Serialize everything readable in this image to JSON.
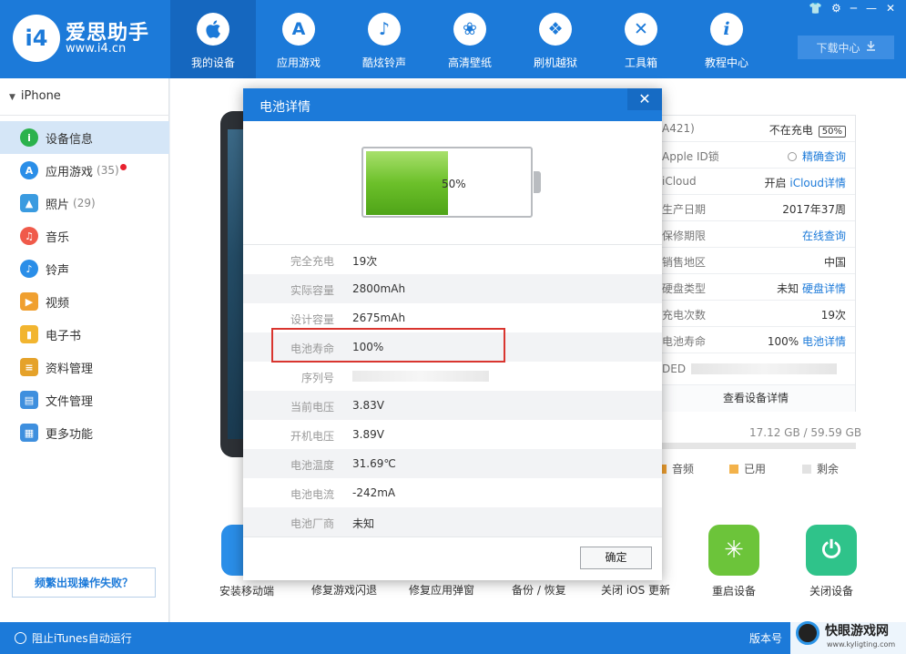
{
  "app": {
    "logo_mark": "i4",
    "title": "爱思助手",
    "url": "www.i4.cn"
  },
  "nav": [
    {
      "label": "我的设备",
      "icon": "apple-icon",
      "glyph": "",
      "active": true
    },
    {
      "label": "应用游戏",
      "icon": "app-store-icon",
      "glyph": "A"
    },
    {
      "label": "酷炫铃声",
      "icon": "bell-icon",
      "glyph": "♪"
    },
    {
      "label": "高清壁纸",
      "icon": "flower-icon",
      "glyph": "❀"
    },
    {
      "label": "刷机越狱",
      "icon": "dropbox-icon",
      "glyph": "❖"
    },
    {
      "label": "工具箱",
      "icon": "tools-icon",
      "glyph": "✕"
    },
    {
      "label": "教程中心",
      "icon": "info-icon",
      "glyph": "i"
    }
  ],
  "window_controls": [
    "👕",
    "⚙",
    "─",
    "—",
    "✕"
  ],
  "download_center": "下载中心",
  "sidebar": {
    "device": "iPhone",
    "items": [
      {
        "label": "设备信息",
        "icon": "info-circle-icon",
        "color": "#2bb24c",
        "glyph": "i",
        "active": true
      },
      {
        "label": "应用游戏",
        "count": "(35)",
        "icon": "app-store-icon",
        "color": "#2a8ee8",
        "glyph": "A",
        "badge": true
      },
      {
        "label": "照片",
        "count": "(29)",
        "icon": "photo-icon",
        "color": "#3a9be0",
        "glyph": "▲"
      },
      {
        "label": "音乐",
        "icon": "music-icon",
        "color": "#f05a4a",
        "glyph": "♫"
      },
      {
        "label": "铃声",
        "icon": "bell-icon",
        "color": "#2a8ee8",
        "glyph": "♪"
      },
      {
        "label": "视频",
        "icon": "video-icon",
        "color": "#f0a030",
        "glyph": "▶"
      },
      {
        "label": "电子书",
        "icon": "book-icon",
        "color": "#f2b530",
        "glyph": "▮"
      },
      {
        "label": "资料管理",
        "icon": "contacts-icon",
        "color": "#e5a22a",
        "glyph": "≡"
      },
      {
        "label": "文件管理",
        "icon": "file-icon",
        "color": "#3e8fde",
        "glyph": "▤"
      },
      {
        "label": "更多功能",
        "icon": "grid-icon",
        "color": "#3e8fde",
        "glyph": "▦"
      }
    ],
    "fail_button": "频繁出现操作失败？"
  },
  "bottom": {
    "itunes": "阻止iTunes自动运行",
    "version": "版本号"
  },
  "info_panel": {
    "model_suffix": "A421)",
    "charge_status": "不在充电",
    "battery_badge": "50%",
    "rows": [
      {
        "k": "Apple ID锁",
        "v": "",
        "link": "精确查询",
        "radio": true
      },
      {
        "k": "iCloud",
        "v": "开启",
        "link": "iCloud详情"
      },
      {
        "k": "生产日期",
        "v": "2017年37周"
      },
      {
        "k": "保修期限",
        "v": "",
        "link": "在线查询"
      },
      {
        "k": "销售地区",
        "v": "中国"
      },
      {
        "k": "硬盘类型",
        "v": "未知",
        "link": "硬盘详情"
      },
      {
        "k": "充电次数",
        "v": "19次"
      },
      {
        "k": "电池寿命",
        "v": "100%",
        "link": "电池详情"
      }
    ],
    "serial_prefix": "DED",
    "detail_button": "查看设备详情",
    "storage": "17.12 GB / 59.59 GB",
    "legend": [
      {
        "label": "音频",
        "color": "#f0a030"
      },
      {
        "label": "已用",
        "color": "#f3b24a"
      },
      {
        "label": "剩余",
        "color": "#e2e2e2"
      }
    ]
  },
  "tools": [
    {
      "label": "安装移动端",
      "icon": "i4-app-icon",
      "color": "#2a8ee8",
      "glyph": "i"
    },
    {
      "label": "修复游戏闪退"
    },
    {
      "label": "修复应用弹窗"
    },
    {
      "label": "备份 / 恢复"
    },
    {
      "label": "关闭 iOS 更新"
    },
    {
      "label": "重启设备",
      "icon": "restart-icon",
      "color": "#6cc43a",
      "glyph": "✳"
    },
    {
      "label": "关闭设备",
      "icon": "power-icon",
      "color": "#2fc38a",
      "glyph": "⏻"
    }
  ],
  "modal": {
    "title": "电池详情",
    "close": "✕",
    "battery_percent": "50%",
    "battery_level": 0.5,
    "rows": [
      {
        "k": "完全充电",
        "v": "19次"
      },
      {
        "k": "实际容量",
        "v": "2800mAh"
      },
      {
        "k": "设计容量",
        "v": "2675mAh"
      },
      {
        "k": "电池寿命",
        "v": "100%"
      },
      {
        "k": "序列号",
        "v": "",
        "masked": true
      },
      {
        "k": "当前电压",
        "v": "3.83V"
      },
      {
        "k": "开机电压",
        "v": "3.89V"
      },
      {
        "k": "电池温度",
        "v": "31.69℃"
      },
      {
        "k": "电池电流",
        "v": "-242mA"
      },
      {
        "k": "电池厂商",
        "v": "未知"
      }
    ],
    "ok": "确定"
  },
  "watermark": {
    "title": "快眼游戏网",
    "url": "www.kyligting.com"
  }
}
